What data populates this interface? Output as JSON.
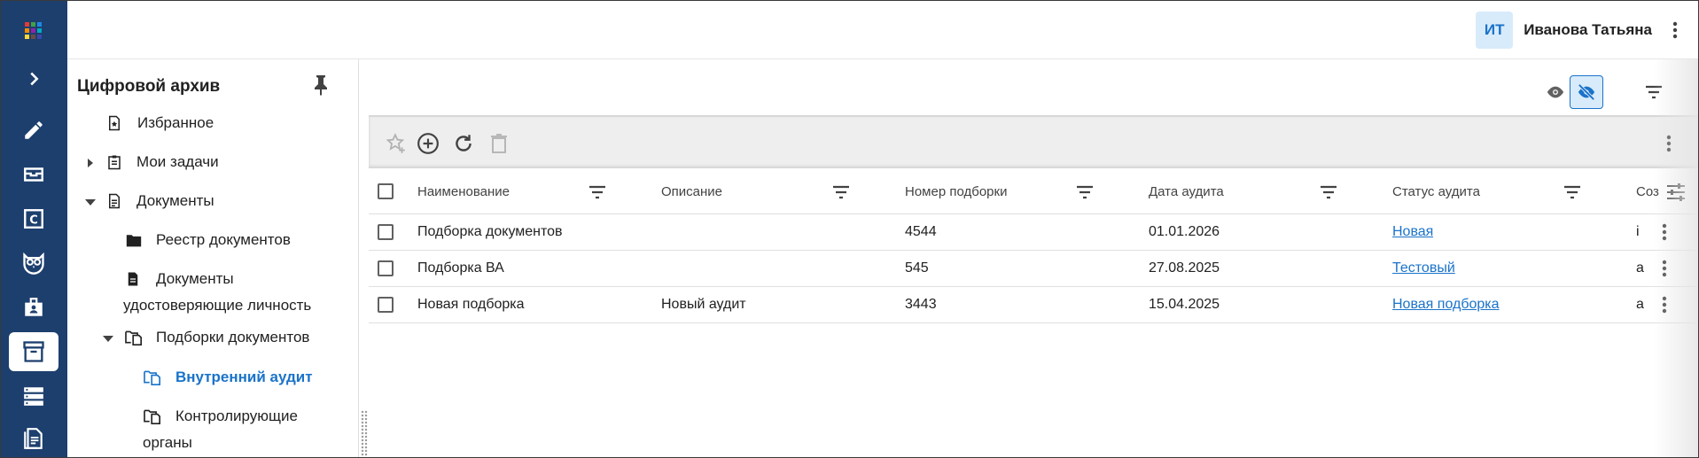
{
  "header": {
    "user_initials": "ИТ",
    "user_name": "Иванова Татьяна"
  },
  "rail": {
    "items": [
      {
        "icon": "apps-grid-icon"
      },
      {
        "icon": "chevron-right-icon"
      },
      {
        "icon": "pencil-icon"
      },
      {
        "icon": "inbox-tray-icon"
      },
      {
        "icon": "c-box-icon"
      },
      {
        "icon": "owl-icon"
      },
      {
        "icon": "badge-icon"
      },
      {
        "icon": "archive-box-icon",
        "active": true
      },
      {
        "icon": "server-icon"
      },
      {
        "icon": "document-list-icon"
      }
    ]
  },
  "tree": {
    "title": "Цифровой архив",
    "nodes": [
      {
        "label": "Избранное"
      },
      {
        "label": "Мои задачи"
      },
      {
        "label": "Документы"
      },
      {
        "label": "Реестр документов"
      },
      {
        "label_line1": "Документы",
        "label_line2": "удостоверяющие личность"
      },
      {
        "label": "Подборки документов"
      },
      {
        "label": "Внутренний аудит",
        "selected": true
      },
      {
        "label_line1": "Контролирующие",
        "label_line2": "органы"
      }
    ]
  },
  "table": {
    "columns": [
      "Наименование",
      "Описание",
      "Номер подборки",
      "Дата аудита",
      "Статус аудита",
      "Соз"
    ],
    "rows": [
      {
        "name": "Подборка документов",
        "description": "",
        "number": "4544",
        "date": "01.01.2026",
        "status": "Новая",
        "created": "i"
      },
      {
        "name": "Подборка ВА",
        "description": "",
        "number": "545",
        "date": "27.08.2025",
        "status": "Тестовый",
        "created": "a"
      },
      {
        "name": "Новая подборка",
        "description": "Новый аудит",
        "number": "3443",
        "date": "15.04.2025",
        "status": "Новая подборка",
        "created": "a"
      }
    ]
  },
  "colors": {
    "rail_bg": "#1d3f6e",
    "accent": "#1a73c9",
    "toolbar_bg": "#eeeeee"
  }
}
